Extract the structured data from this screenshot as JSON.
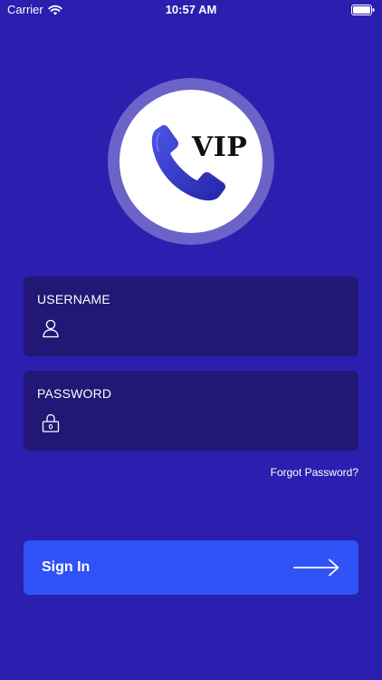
{
  "status_bar": {
    "carrier": "Carrier",
    "time": "10:57 AM"
  },
  "logo": {
    "text": "VIP",
    "icon": "phone-handset-icon"
  },
  "form": {
    "username_label": "USERNAME",
    "username_value": "",
    "username_icon": "user-icon",
    "password_label": "PASSWORD",
    "password_value": "",
    "password_icon": "lock-icon",
    "forgot_password": "Forgot Password?"
  },
  "signin": {
    "label": "Sign In",
    "icon": "arrow-right-icon"
  },
  "colors": {
    "background": "#2a1fae",
    "field_background": "#221774",
    "button": "#2f53f7",
    "logo_ring": "#6b63c8",
    "phone": "#2f35c8"
  }
}
